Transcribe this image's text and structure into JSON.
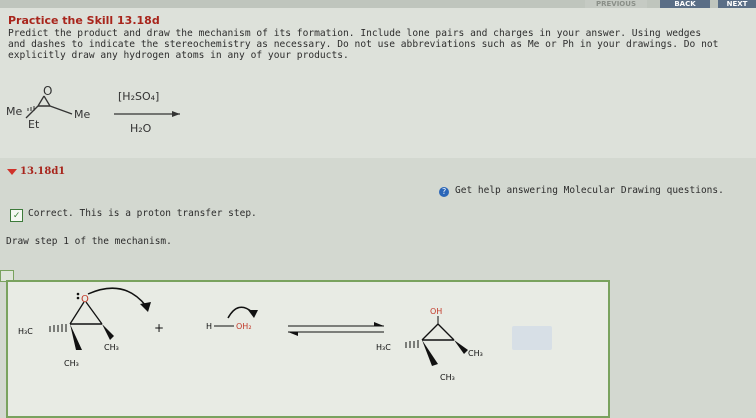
{
  "nav": {
    "prev_label": "PREVIOUS",
    "back_label": "BACK",
    "next_label": "NEXT"
  },
  "problem": {
    "title": "Practice the Skill 13.18d",
    "instructions_line1": "Predict the product and draw the mechanism of its formation. Include lone pairs and charges in your answer. Using wedges",
    "instructions_line2": "and dashes to indicate the stereochemistry as necessary. Do not use abbreviations such as Me or Ph in your drawings. Do not",
    "instructions_line3": "explicitly draw any hydrogen atoms in any of your products.",
    "reactant": {
      "sub_left": "Me",
      "sub_right": "Me",
      "sub_bottom": "Et",
      "ring_atom": "O"
    },
    "reagent_top": "[H₂SO₄]",
    "reagent_bottom": "H₂O"
  },
  "part": {
    "label": "13.18d1",
    "help_text": "Get help answering Molecular Drawing questions.",
    "help_icon": "question-icon",
    "correct_text": "Correct. This is a proton transfer step.",
    "step_text": "Draw step 1 of the mechanism."
  },
  "mechanism": {
    "epoxide": {
      "oxygen": "O",
      "methyl_left": "H₃C",
      "methyl_right": "CH₃",
      "methyl_bottom": "CH₃"
    },
    "plus": "+",
    "acid": {
      "h": "H",
      "oh": "OH₂"
    },
    "product": {
      "oh": "OH",
      "methyl_left": "H₃C",
      "methyl_right": "CH₃",
      "methyl_bottom": "CH₃"
    }
  },
  "colors": {
    "title_red": "#a8251c",
    "canvas_border": "#79a25e",
    "help_blue": "#2a66b8"
  }
}
